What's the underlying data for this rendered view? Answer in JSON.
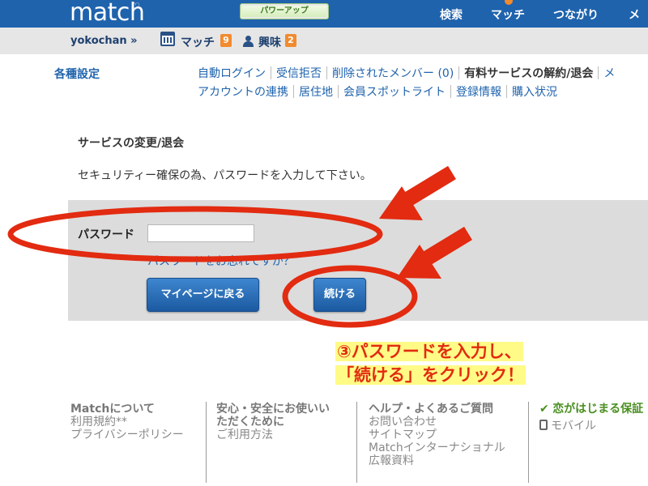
{
  "header": {
    "logo": "match",
    "powerup_label": "パワーアップ",
    "nav": [
      "検索",
      "マッチ",
      "つながり",
      "メッ"
    ]
  },
  "subheader": {
    "username": "yokochan »",
    "match_label": "マッチ",
    "match_count": "9",
    "interest_label": "興味",
    "interest_count": "2"
  },
  "settings": {
    "title": "各種設定",
    "row1": [
      "自動ログイン",
      "受信拒否",
      "削除されたメンバー (0)",
      "有料サービスの解約/退会",
      "メ"
    ],
    "row2": [
      "アカウントの連携",
      "居住地",
      "会員スポットライト",
      "登録情報",
      "購入状況"
    ]
  },
  "main": {
    "section_title": "サービスの変更/退会",
    "instruction": "セキュリティー確保の為、パスワードを入力して下さい。",
    "password_label": "パスワード",
    "password_value": "",
    "forgot_link": "パスワードをお忘れですか？",
    "back_button": "マイページに戻る",
    "continue_button": "続ける"
  },
  "annotation": {
    "line1": "③パスワードを入力し、",
    "line2": "「続ける」をクリック！",
    "color": "#e22b10",
    "highlight": "#fffb86"
  },
  "footer": {
    "col1": {
      "head": "Matchについて",
      "links": [
        "利用規約**",
        "プライバシーポリシー"
      ]
    },
    "col2": {
      "head_line1": "安心・安全にお使いい",
      "head_line2": "ただくために",
      "links": [
        "ご利用方法"
      ]
    },
    "col3": {
      "head": "ヘルプ・よくあるご質問",
      "links": [
        "お問い合わせ",
        "サイトマップ",
        "Matchインターナショナル",
        "広報資料"
      ]
    },
    "col4": {
      "head": "恋がはじまる保証",
      "links": [
        "モバイル"
      ]
    }
  }
}
